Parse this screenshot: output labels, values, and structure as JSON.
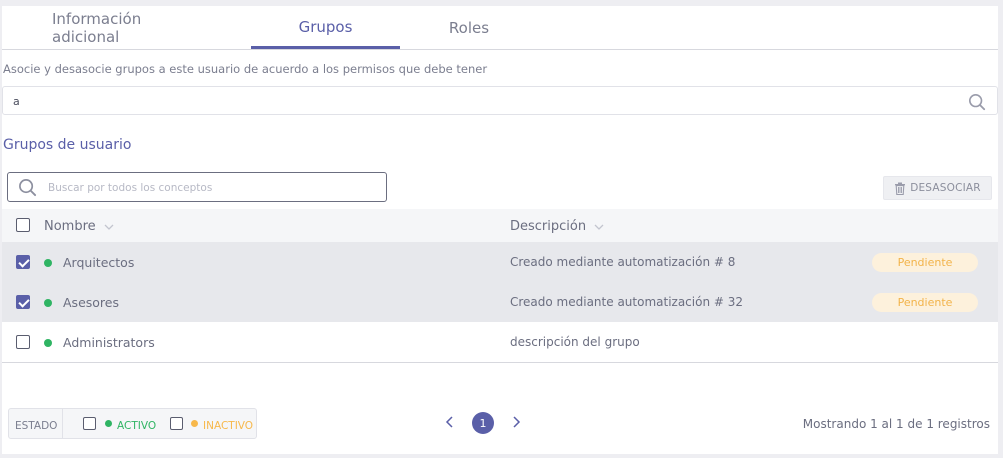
{
  "tabs": [
    {
      "label": "Información adicional"
    },
    {
      "label": "Grupos"
    },
    {
      "label": "Roles"
    }
  ],
  "description": "Asocie y desasocie grupos a este usuario de acuerdo a los permisos que debe tener",
  "filter": {
    "value": "a"
  },
  "section_title": "Grupos de usuario",
  "search": {
    "placeholder": "Buscar por todos los conceptos"
  },
  "desasociar_label": "DESASOCIAR",
  "table": {
    "headers": {
      "name": "Nombre",
      "description": "Descripción"
    },
    "rows": [
      {
        "name": "Arquitectos",
        "description": "Creado mediante automatización # 8",
        "badge": "Pendiente",
        "checked": true
      },
      {
        "name": "Asesores",
        "description": "Creado mediante automatización # 32",
        "badge": "Pendiente",
        "checked": true
      },
      {
        "name": "Administrators",
        "description": "descripción del grupo",
        "badge": "",
        "checked": false
      }
    ]
  },
  "estado": {
    "label": "ESTADO",
    "activo": "ACTIVO",
    "inactivo": "INACTIVO"
  },
  "pagination": {
    "current_page": "1",
    "summary": "Mostrando 1 al 1 de 1 registros"
  },
  "colors": {
    "accent": "#5a5fa8",
    "active": "#2fb463",
    "inactive": "#f7b84b",
    "pending_bg": "#fdf1dc",
    "pending_text": "#f2b34a"
  }
}
